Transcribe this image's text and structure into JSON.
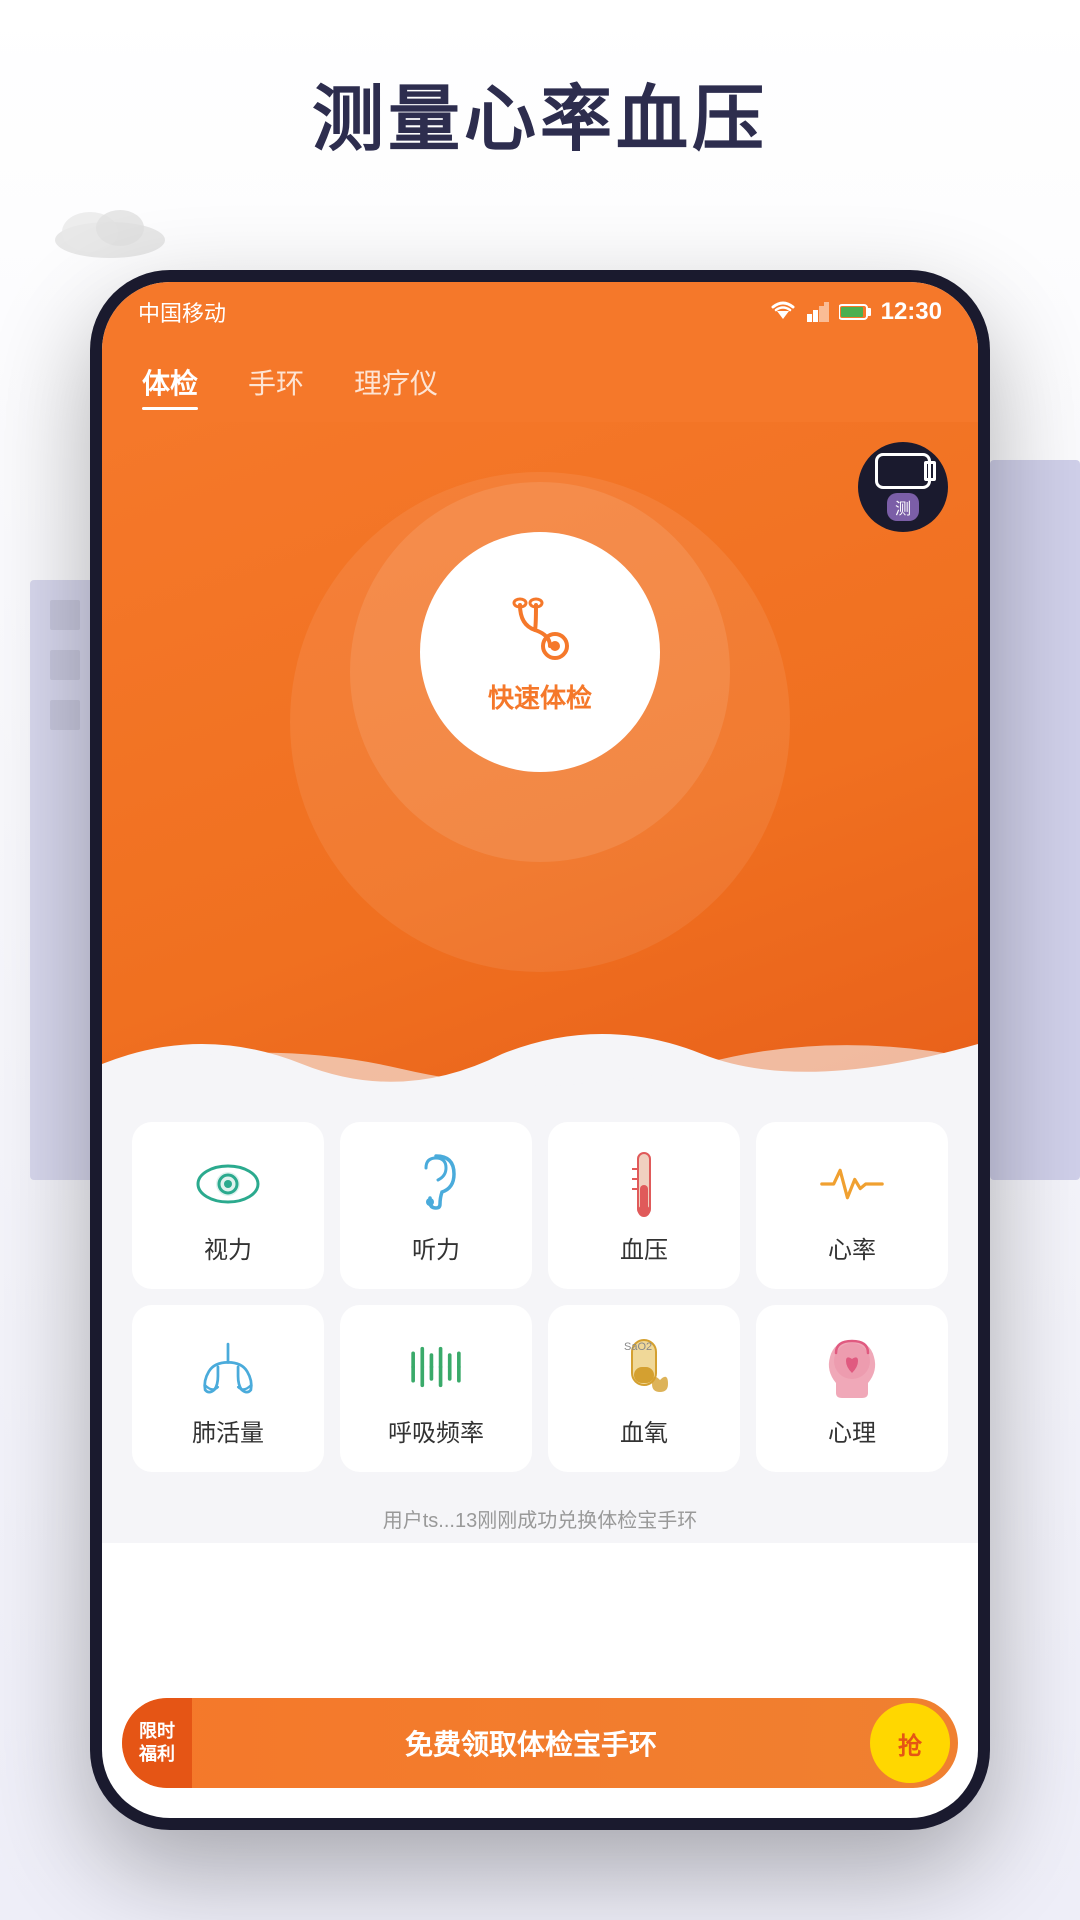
{
  "page": {
    "title": "测量心率血压",
    "background_color": "#f0f0f8"
  },
  "status_bar": {
    "carrier": "中国移动",
    "time": "12:30"
  },
  "nav": {
    "tabs": [
      {
        "id": "tiyian",
        "label": "体检",
        "active": true
      },
      {
        "id": "shuhuan",
        "label": "手环",
        "active": false
      },
      {
        "id": "liiaoyiyi",
        "label": "理疗仪",
        "active": false
      }
    ]
  },
  "center_button": {
    "label": "快速体检"
  },
  "device_badge": {
    "label": "测"
  },
  "grid_items_row1": [
    {
      "id": "vision",
      "label": "视力",
      "icon_color": "#2baa8e"
    },
    {
      "id": "hearing",
      "label": "听力",
      "icon_color": "#4aabdb"
    },
    {
      "id": "bp",
      "label": "血压",
      "icon_color": "#e05a5a"
    },
    {
      "id": "heartrate",
      "label": "心率",
      "icon_color": "#f0a030"
    }
  ],
  "grid_items_row2": [
    {
      "id": "lung",
      "label": "肺活量",
      "icon_color": "#4aabdb"
    },
    {
      "id": "breath",
      "label": "呼吸频率",
      "icon_color": "#3aaa6a"
    },
    {
      "id": "blood_oxygen",
      "label": "血氧",
      "icon_color": "#d4a030"
    },
    {
      "id": "mental",
      "label": "心理",
      "icon_color": "#e05a80"
    }
  ],
  "scroll_text": "用户ts...13刚刚成功兑换体检宝手环",
  "banner": {
    "tag_line1": "限时",
    "tag_line2": "福利",
    "text": "免费领取体检宝手环",
    "btn_label": "抢"
  }
}
